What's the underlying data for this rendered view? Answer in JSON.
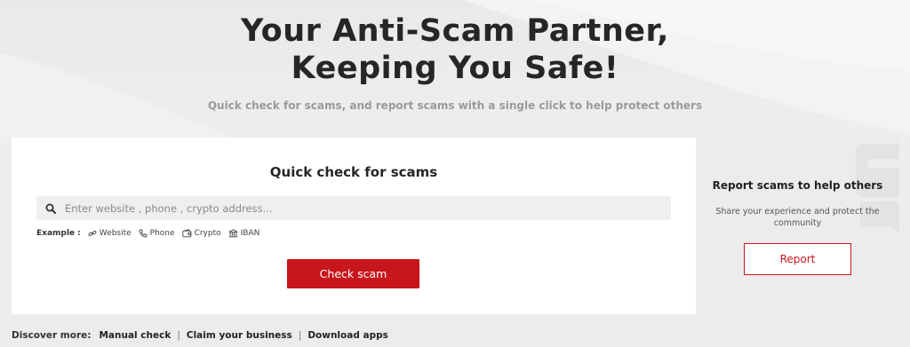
{
  "hero": {
    "title_line1": "Your Anti-Scam Partner,",
    "title_line2": "Keeping You Safe!",
    "subtitle": "Quick check for scams, and report scams with a single click to help protect others"
  },
  "quick_check": {
    "title": "Quick check for scams",
    "search": {
      "placeholder": "Enter website , phone , crypto address...",
      "value": ""
    },
    "examples_label": "Example :",
    "examples": [
      {
        "label": "Website",
        "icon": "link-icon"
      },
      {
        "label": "Phone",
        "icon": "phone-icon"
      },
      {
        "label": "Crypto",
        "icon": "wallet-icon"
      },
      {
        "label": "IBAN",
        "icon": "bank-icon"
      }
    ],
    "button_label": "Check scam"
  },
  "report": {
    "title": "Report scams to help others",
    "text": "Share your experience and protect the community",
    "button_label": "Report"
  },
  "discover": {
    "label": "Discover more:",
    "links": [
      "Manual check",
      "Claim your business",
      "Download apps"
    ],
    "separator": "|"
  },
  "colors": {
    "accent": "#c8161d",
    "background": "#ececec",
    "card": "#ffffff"
  }
}
